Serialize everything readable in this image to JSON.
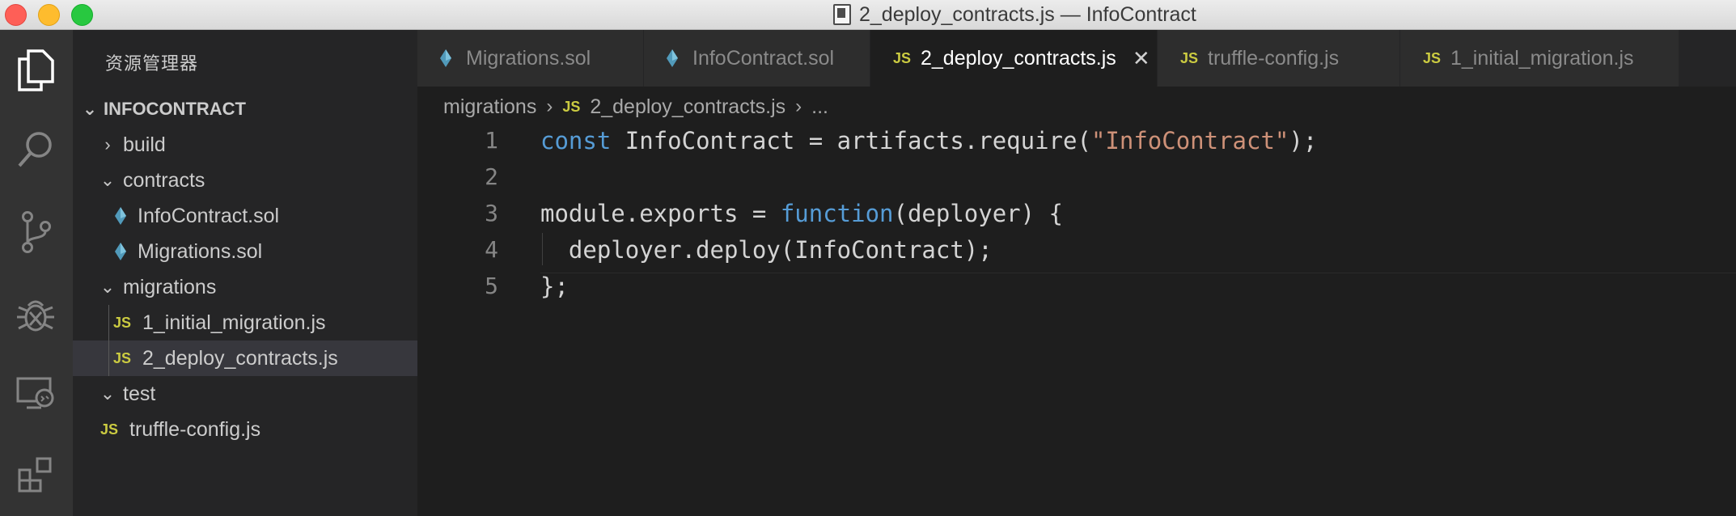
{
  "window": {
    "title": "2_deploy_contracts.js — InfoContract"
  },
  "sidebar": {
    "title": "资源管理器",
    "project": "INFOCONTRACT",
    "items": [
      {
        "label": "build"
      },
      {
        "label": "contracts"
      },
      {
        "label": "InfoContract.sol"
      },
      {
        "label": "Migrations.sol"
      },
      {
        "label": "migrations"
      },
      {
        "label": "1_initial_migration.js"
      },
      {
        "label": "2_deploy_contracts.js"
      },
      {
        "label": "test"
      },
      {
        "label": "truffle-config.js"
      }
    ]
  },
  "tabs": [
    {
      "label": "Migrations.sol",
      "icon": "ethereum-icon",
      "active": false
    },
    {
      "label": "InfoContract.sol",
      "icon": "ethereum-icon",
      "active": false
    },
    {
      "label": "2_deploy_contracts.js",
      "icon": "js-icon",
      "active": true
    },
    {
      "label": "truffle-config.js",
      "icon": "js-icon",
      "active": false
    },
    {
      "label": "1_initial_migration.js",
      "icon": "js-icon",
      "active": false
    }
  ],
  "icons": {
    "js_badge": "JS"
  },
  "breadcrumb": {
    "folder": "migrations",
    "file": "2_deploy_contracts.js",
    "more": "..."
  },
  "editor": {
    "line_numbers": [
      "1",
      "2",
      "3",
      "4",
      "5"
    ],
    "lines": [
      {
        "t1": "const",
        "t2": " InfoContract = artifacts.require(",
        "t3": "\"InfoContract\"",
        "t4": ");"
      },
      {
        "text": ""
      },
      {
        "t1": "module.exports = ",
        "t2": "function",
        "t3": "(deployer) {"
      },
      {
        "text": "  deployer.deploy(InfoContract);"
      },
      {
        "text": "};"
      }
    ]
  },
  "colors": {
    "keyword": "#569cd6",
    "string": "#ce9178",
    "js_icon": "#cbcb41",
    "sol_icon": "#519aba"
  }
}
